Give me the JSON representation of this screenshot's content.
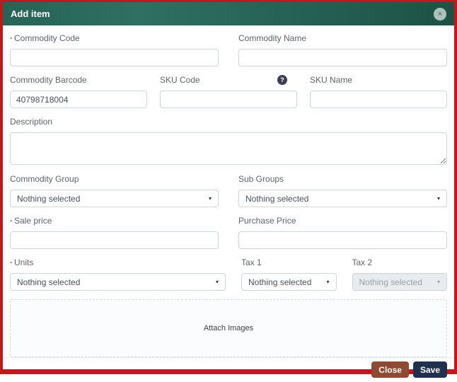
{
  "window": {
    "title": "Add item",
    "close_icon": "×"
  },
  "form": {
    "required_marker": "·",
    "caret_icon": "▾",
    "commodity_code": {
      "label": "Commodity Code",
      "required": true,
      "value": ""
    },
    "commodity_name": {
      "label": "Commodity Name",
      "value": ""
    },
    "commodity_barcode": {
      "label": "Commodity Barcode",
      "value": "40798718004"
    },
    "sku_code": {
      "label": "SKU Code",
      "help_icon": "?",
      "value": ""
    },
    "sku_name": {
      "label": "SKU Name",
      "value": ""
    },
    "description": {
      "label": "Description",
      "value": ""
    },
    "commodity_group": {
      "label": "Commodity Group",
      "selected": "Nothing selected"
    },
    "sub_groups": {
      "label": "Sub Groups",
      "selected": "Nothing selected"
    },
    "sale_price": {
      "label": "Sale price",
      "required": true,
      "value": ""
    },
    "purchase_price": {
      "label": "Purchase Price",
      "value": ""
    },
    "units": {
      "label": "Units",
      "required": true,
      "selected": "Nothing selected"
    },
    "tax1": {
      "label": "Tax 1",
      "selected": "Nothing selected"
    },
    "tax2": {
      "label": "Tax 2",
      "selected": "Nothing selected",
      "disabled": true
    },
    "attach_images": {
      "label": "Attach Images"
    }
  },
  "footer": {
    "close_label": "Close",
    "save_label": "Save"
  },
  "colors": {
    "frame_border": "#c0181c",
    "header_gradient_start": "#2e7063",
    "header_gradient_end": "#1d5246",
    "close_button": "#8e4a32",
    "save_button": "#22304f"
  }
}
